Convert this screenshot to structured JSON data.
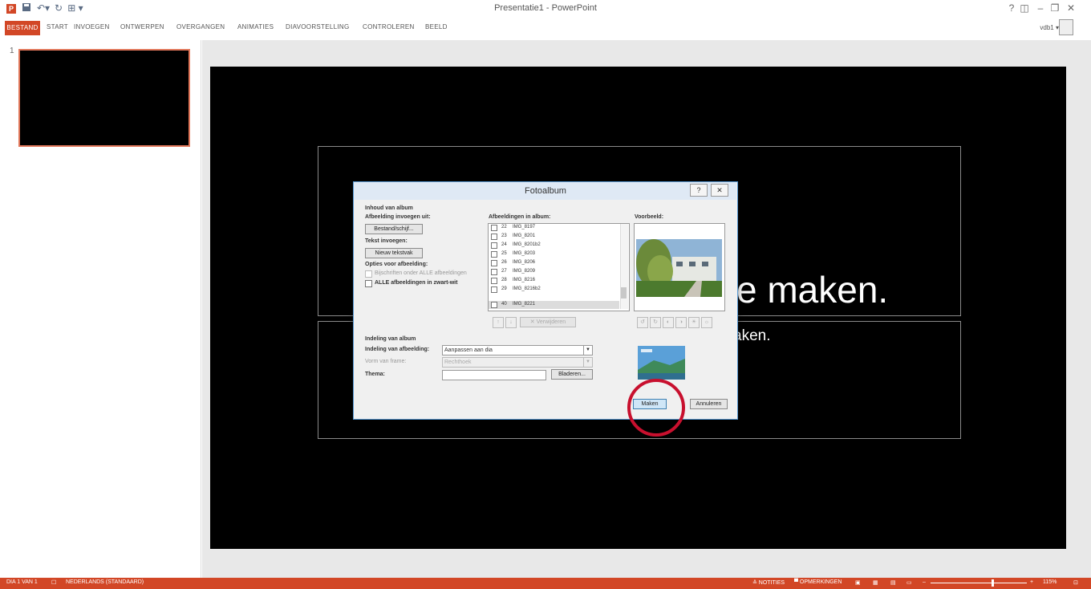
{
  "window": {
    "app_title": "Presentatie1 - PowerPoint",
    "help": "?",
    "restore_ribbon": "◫",
    "minimize": "–",
    "maximize": "❐",
    "close": "✕",
    "user": "vdb1 ▾"
  },
  "qat": {
    "undo": "↶▾",
    "redo": "↻",
    "customize": "⊞ ▾"
  },
  "ribbon": {
    "tabs": [
      "BESTAND",
      "START",
      "INVOEGEN",
      "ONTWERPEN",
      "OVERGANGEN",
      "ANIMATIES",
      "DIAVOORSTELLING",
      "CONTROLEREN",
      "BEELD"
    ]
  },
  "thumbnails": {
    "slide_number": "1"
  },
  "slide": {
    "title_fragment": "e maken.",
    "subtitle_fragment": "aken."
  },
  "dialog": {
    "title": "Fotoalbum",
    "help": "?",
    "close": "✕",
    "album_content_heading": "Inhoud van album",
    "insert_picture_from": "Afbeelding invoegen uit:",
    "file_disk_button": "Bestand/schijf...",
    "insert_text": "Tekst invoegen:",
    "new_textbox_button": "Nieuw tekstvak",
    "picture_options": "Opties voor afbeelding:",
    "captions_option": "Bijschriften onder ALLE afbeeldingen",
    "bw_option": "ALLE afbeeldingen in zwart-wit",
    "pictures_in_album": "Afbeeldingen in album:",
    "list_items": [
      {
        "num": "22",
        "name": "IMG_8197"
      },
      {
        "num": "23",
        "name": "IMG_8201"
      },
      {
        "num": "24",
        "name": "IMG_8201b2"
      },
      {
        "num": "25",
        "name": "IMG_8203"
      },
      {
        "num": "26",
        "name": "IMG_8206"
      },
      {
        "num": "27",
        "name": "IMG_8209"
      },
      {
        "num": "28",
        "name": "IMG_8216"
      },
      {
        "num": "29",
        "name": "IMG_8216b2"
      },
      {
        "num": "40",
        "name": "IMG_8221"
      }
    ],
    "remove_button": "Verwijderen",
    "preview_label": "Voorbeeld:",
    "album_layout_heading": "Indeling van album",
    "picture_layout_label": "Indeling van afbeelding:",
    "picture_layout_value": "Aanpassen aan dia",
    "frame_shape_label": "Vorm van frame:",
    "frame_shape_value": "Rechthoek",
    "theme_label": "Thema:",
    "browse_button": "Bladeren...",
    "create_button": "Maken",
    "cancel_button": "Annuleren"
  },
  "statusbar": {
    "slide_info": "DIA 1 VAN 1",
    "language": "NEDERLANDS (STANDAARD)",
    "notes": "≙ NOTITIES",
    "comments": "▀ OPMERKINGEN",
    "zoom": "115%"
  },
  "colors": {
    "accent": "#d24726",
    "highlight_circle": "#c8102e",
    "slide_bg": "#000000"
  }
}
